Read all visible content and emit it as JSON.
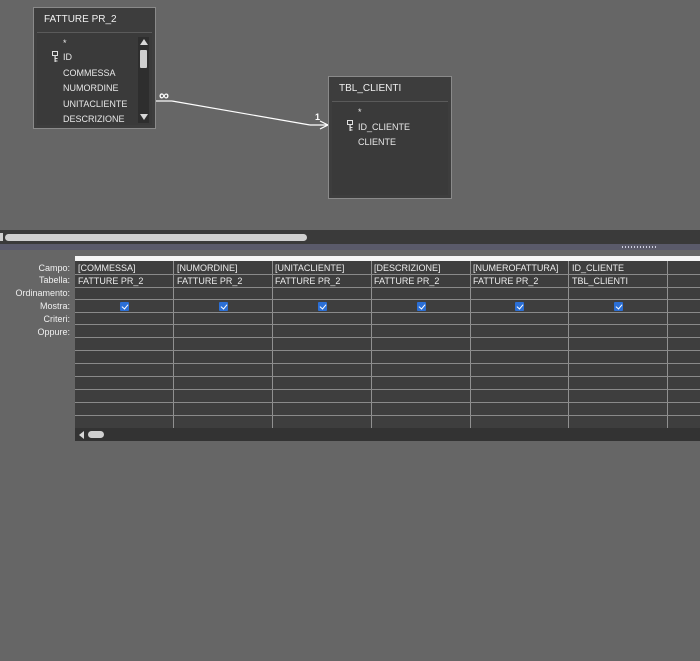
{
  "tables": [
    {
      "title": "FATTURE PR_2",
      "fields": [
        "*",
        "ID",
        "COMMESSA",
        "NUMORDINE",
        "UNITACLIENTE",
        "DESCRIZIONE"
      ],
      "key_field_index": 1
    },
    {
      "title": "TBL_CLIENTI",
      "fields": [
        "*",
        "ID_CLIENTE",
        "CLIENTE"
      ],
      "key_field_index": 1
    }
  ],
  "relationship": {
    "from_label": "∞",
    "to_label": "1"
  },
  "grid": {
    "row_labels": [
      "Campo:",
      "Tabella:",
      "Ordinamento:",
      "Mostra:",
      "Criteri:",
      "Oppure:"
    ],
    "columns": [
      {
        "campo": "[COMMESSA]",
        "tabella": "FATTURE PR_2",
        "mostra": true
      },
      {
        "campo": "[NUMORDINE]",
        "tabella": "FATTURE PR_2",
        "mostra": true
      },
      {
        "campo": "[UNITACLIENTE]",
        "tabella": "FATTURE PR_2",
        "mostra": true
      },
      {
        "campo": "[DESCRIZIONE]",
        "tabella": "FATTURE PR_2",
        "mostra": true
      },
      {
        "campo": "[NUMEROFATTURA]",
        "tabella": "FATTURE PR_2",
        "mostra": true
      },
      {
        "campo": "ID_CLIENTE",
        "tabella": "TBL_CLIENTI",
        "mostra": true
      },
      {
        "campo": "",
        "tabella": "",
        "mostra": false
      }
    ]
  },
  "colors": {
    "background": "#666666",
    "table_box": "#3d3d3d",
    "checkbox": "#2b6fd6"
  }
}
